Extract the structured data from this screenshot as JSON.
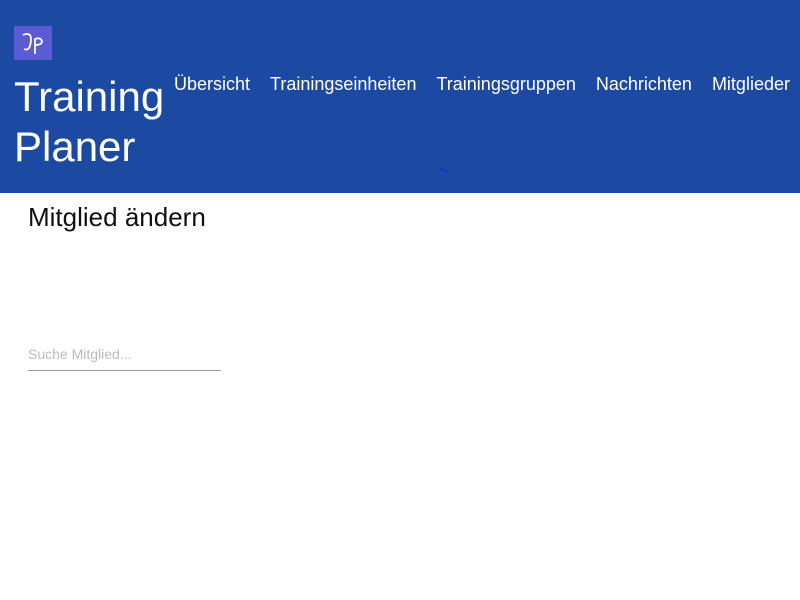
{
  "header": {
    "logo_text": "JP",
    "brand": "Training Planer",
    "nav": [
      "Übersicht",
      "Trainingseinheiten",
      "Trainingsgruppen",
      "Nachrichten",
      "Mitglieder"
    ]
  },
  "main": {
    "title": "Mitglied ändern",
    "search_placeholder": "Suche Mitglied..."
  }
}
